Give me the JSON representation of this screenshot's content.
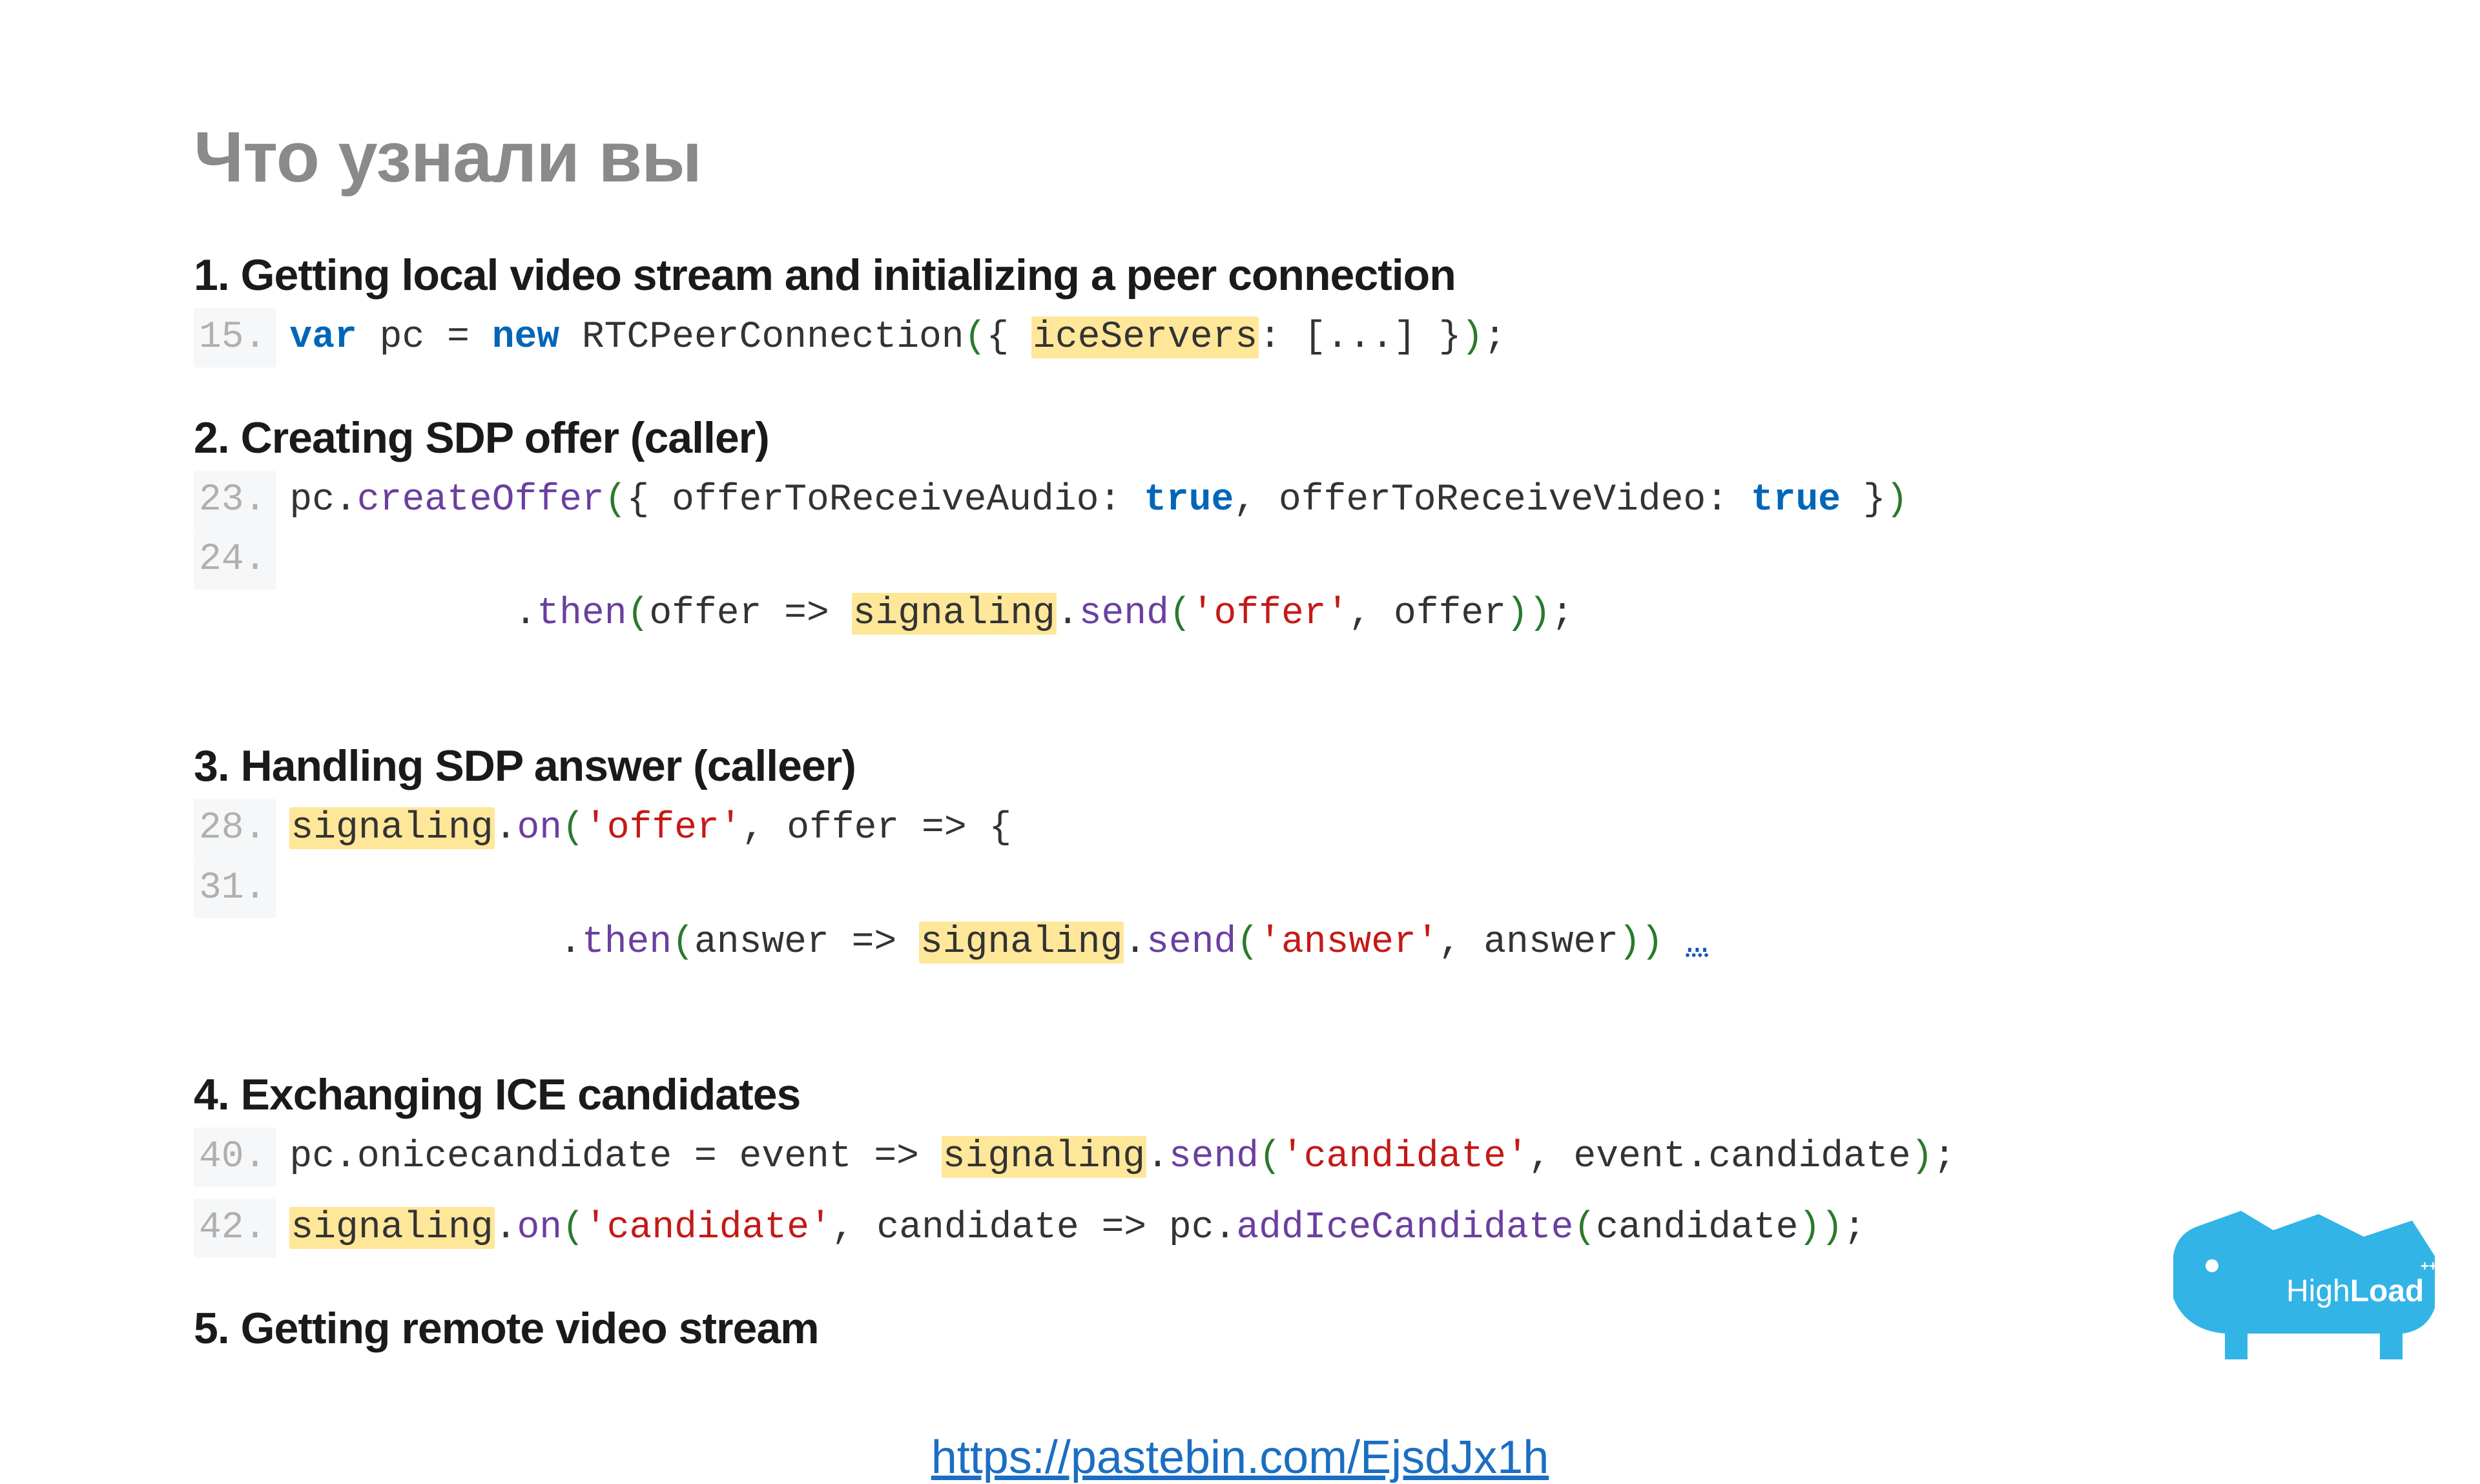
{
  "title": "Что узнали вы",
  "sections": {
    "s1": {
      "heading": "1. Getting local video stream and initializing a peer connection"
    },
    "s2": {
      "heading": "2. Creating SDP offer (caller)"
    },
    "s3": {
      "heading": "3. Handling SDP answer (calleer)"
    },
    "s4": {
      "heading": "4. Exchanging ICE candidates"
    },
    "s5": {
      "heading": "5. Getting remote video stream"
    }
  },
  "lines": {
    "l15": {
      "no": "15.",
      "a": "var",
      "b": " pc = ",
      "c": "new",
      "d": " RTCPeerConnection",
      "e": "(",
      "f": "{ ",
      "g": "iceServers",
      "h": ": [...] }",
      "i": ")",
      "j": ";"
    },
    "l23": {
      "no": "23.",
      "a": "pc.",
      "b": "createOffer",
      "c": "(",
      "d": "{ offerToReceiveAudio: ",
      "e": "true",
      "f": ", offerToReceiveVideo: ",
      "g": "true",
      "h": " }",
      "i": ")"
    },
    "l24": {
      "no": "24.",
      "a": "  .",
      "b": "then",
      "c": "(",
      "d": "offer => ",
      "e": "signaling",
      "f": ".",
      "g": "send",
      "h": "(",
      "i": "'offer'",
      "j": ", offer",
      "k": ")",
      "l": ")",
      "m": ";"
    },
    "l28": {
      "no": "28.",
      "a": "signaling",
      "b": ".",
      "c": "on",
      "d": "(",
      "e": "'offer'",
      "f": ", offer => {"
    },
    "l31": {
      "no": "31.",
      "a": "    .",
      "b": "then",
      "c": "(",
      "d": "answer => ",
      "e": "signaling",
      "f": ".",
      "g": "send",
      "h": "(",
      "i": "'answer'",
      "j": ", answer",
      "k": ")",
      "l": ")",
      "m": " ",
      "n": "…"
    },
    "l40": {
      "no": "40.",
      "a": "pc.onicecandidate = event => ",
      "b": "signaling",
      "c": ".",
      "d": "send",
      "e": "(",
      "f": "'candidate'",
      "g": ", event.candidate",
      "h": ")",
      "i": ";"
    },
    "l42": {
      "no": "42.",
      "a": "signaling",
      "b": ".",
      "c": "on",
      "d": "(",
      "e": "'candidate'",
      "f": ", candidate => pc.",
      "g": "addIceCandidate",
      "h": "(",
      "i": "candidate",
      "j": ")",
      "k": ")",
      "l": ";"
    }
  },
  "link": {
    "text": "https://pastebin.com/EjsdJx1h",
    "href": "https://pastebin.com/EjsdJx1h"
  },
  "logo": {
    "light": "High",
    "bold": "Load",
    "plus": "++"
  }
}
